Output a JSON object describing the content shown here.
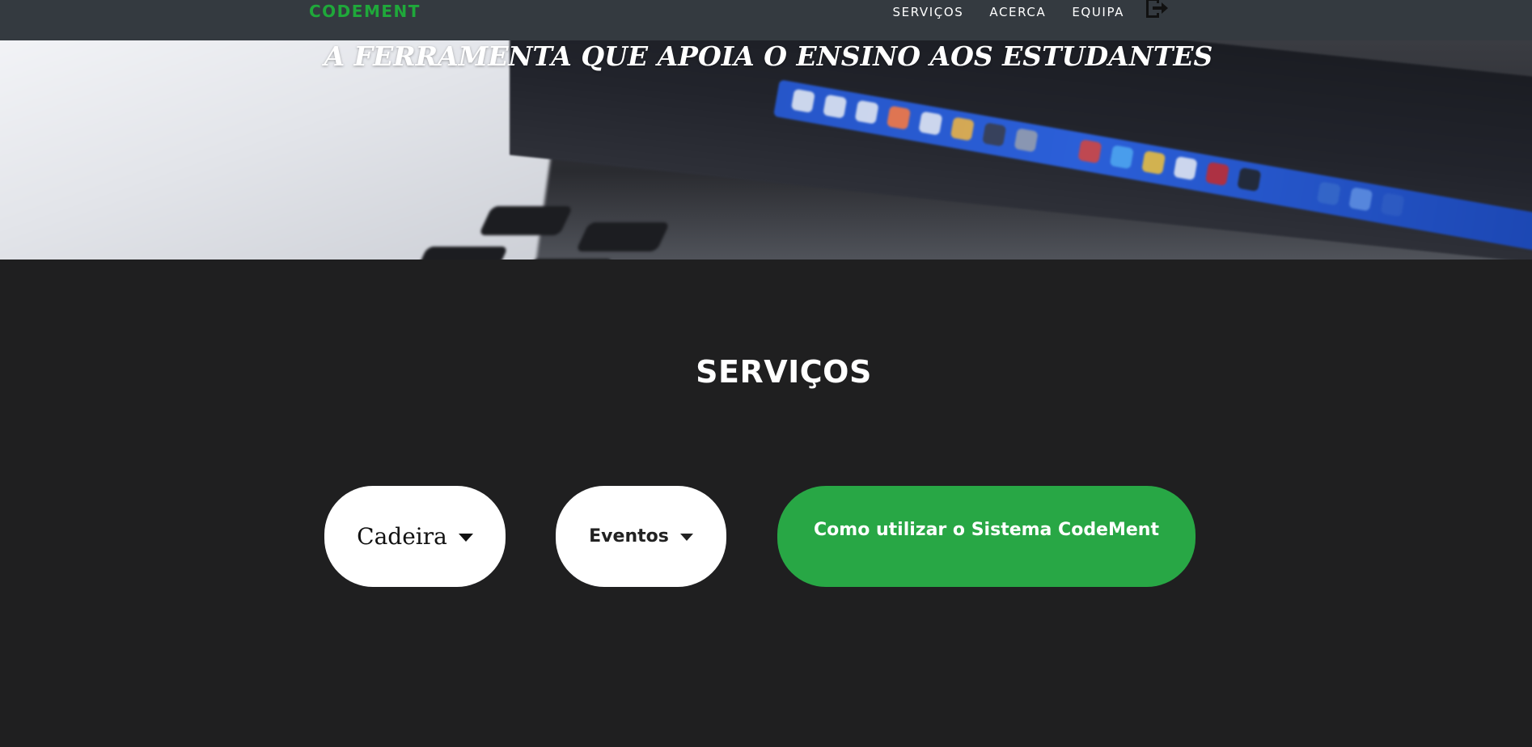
{
  "navbar": {
    "brand": "CODEMENT",
    "links": [
      "SERVIÇOS",
      "ACERCA",
      "EQUIPA"
    ],
    "logout_icon": "logout-icon"
  },
  "hero": {
    "title": "A FERRAMENTA QUE APOIA O ENSINO AOS ESTUDANTES"
  },
  "services": {
    "title": "SERVIÇOS",
    "dropdowns": [
      "Cadeira",
      "Eventos"
    ],
    "guide_button": "Como utilizar o Sistema CodeMent"
  },
  "colors": {
    "brand": "#1fa83a",
    "navbar_bg": "#343a40",
    "page_bg": "#1f1f20",
    "primary_button": "#28a745"
  }
}
